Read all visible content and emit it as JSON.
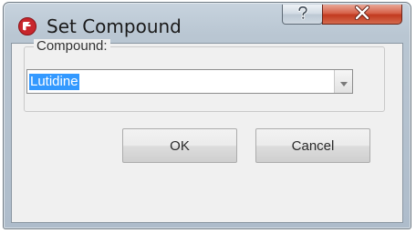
{
  "window": {
    "title": "Set Compound",
    "icon": "app-logo-icon",
    "help_icon": "question-mark-icon",
    "close_icon": "close-x-icon",
    "colors": {
      "close_button": "#c8432a",
      "selection": "#3399ff"
    }
  },
  "compound_group": {
    "label": "Compound:"
  },
  "compound_select": {
    "value": "Lutidine",
    "selected": true,
    "dropdown_icon": "chevron-down-icon"
  },
  "buttons": {
    "ok_label": "OK",
    "cancel_label": "Cancel"
  }
}
